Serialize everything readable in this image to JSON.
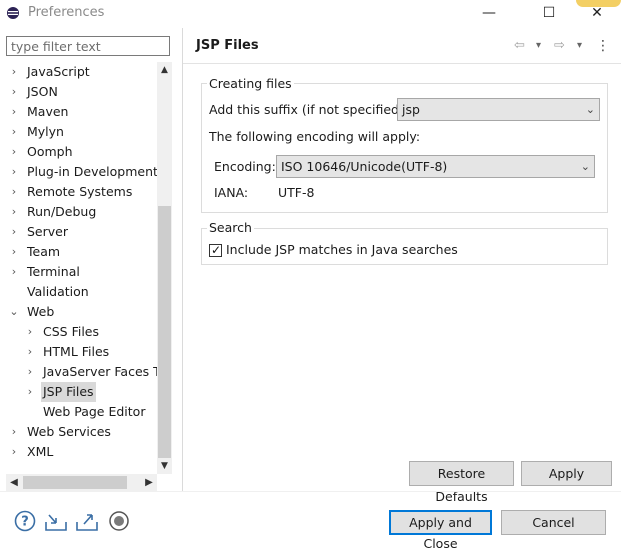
{
  "window": {
    "title": "Preferences",
    "controls": {
      "minimize": "—",
      "maximize": "☐",
      "close": "✕"
    }
  },
  "filter": {
    "placeholder": "type filter text",
    "value": ""
  },
  "tree": {
    "items": [
      {
        "label": "JavaScript",
        "level": 0,
        "arrow": "›"
      },
      {
        "label": "JSON",
        "level": 0,
        "arrow": "›"
      },
      {
        "label": "Maven",
        "level": 0,
        "arrow": "›"
      },
      {
        "label": "Mylyn",
        "level": 0,
        "arrow": "›"
      },
      {
        "label": "Oomph",
        "level": 0,
        "arrow": "›"
      },
      {
        "label": "Plug-in Development",
        "level": 0,
        "arrow": "›"
      },
      {
        "label": "Remote Systems",
        "level": 0,
        "arrow": "›"
      },
      {
        "label": "Run/Debug",
        "level": 0,
        "arrow": "›"
      },
      {
        "label": "Server",
        "level": 0,
        "arrow": "›"
      },
      {
        "label": "Team",
        "level": 0,
        "arrow": "›"
      },
      {
        "label": "Terminal",
        "level": 0,
        "arrow": "›"
      },
      {
        "label": "Validation",
        "level": 0,
        "arrow": ""
      },
      {
        "label": "Web",
        "level": 0,
        "arrow": "⌄"
      },
      {
        "label": "CSS Files",
        "level": 1,
        "arrow": "›"
      },
      {
        "label": "HTML Files",
        "level": 1,
        "arrow": "›"
      },
      {
        "label": "JavaServer Faces To",
        "level": 1,
        "arrow": "›"
      },
      {
        "label": "JSP Files",
        "level": 1,
        "arrow": "›",
        "selected": true
      },
      {
        "label": "Web Page Editor",
        "level": 1,
        "arrow": ""
      },
      {
        "label": "Web Services",
        "level": 0,
        "arrow": "›"
      },
      {
        "label": "XML",
        "level": 0,
        "arrow": "›"
      }
    ]
  },
  "page": {
    "title": "JSP Files",
    "nav": {
      "back": "⇦",
      "back_menu": "▾",
      "forward": "⇨",
      "forward_menu": "▾",
      "more": "⋮"
    }
  },
  "creating_files": {
    "legend": "Creating files",
    "suffix_label": "Add this suffix (if not specified):",
    "suffix_value": "jsp",
    "encoding_note": "The following encoding will apply:",
    "encoding_label": "Encoding:",
    "encoding_value": "ISO 10646/Unicode(UTF-8)",
    "iana_label": "IANA:",
    "iana_value": "UTF-8"
  },
  "search": {
    "legend": "Search",
    "include_label": "Include JSP matches in Java searches",
    "include_checked": true
  },
  "buttons": {
    "restore_defaults": "Restore Defaults",
    "apply": "Apply",
    "apply_and_close": "Apply and Close",
    "cancel": "Cancel"
  },
  "colors": {
    "accent": "#0078d7",
    "selection": "#d9d9d9",
    "button_face": "#e1e1e1"
  }
}
